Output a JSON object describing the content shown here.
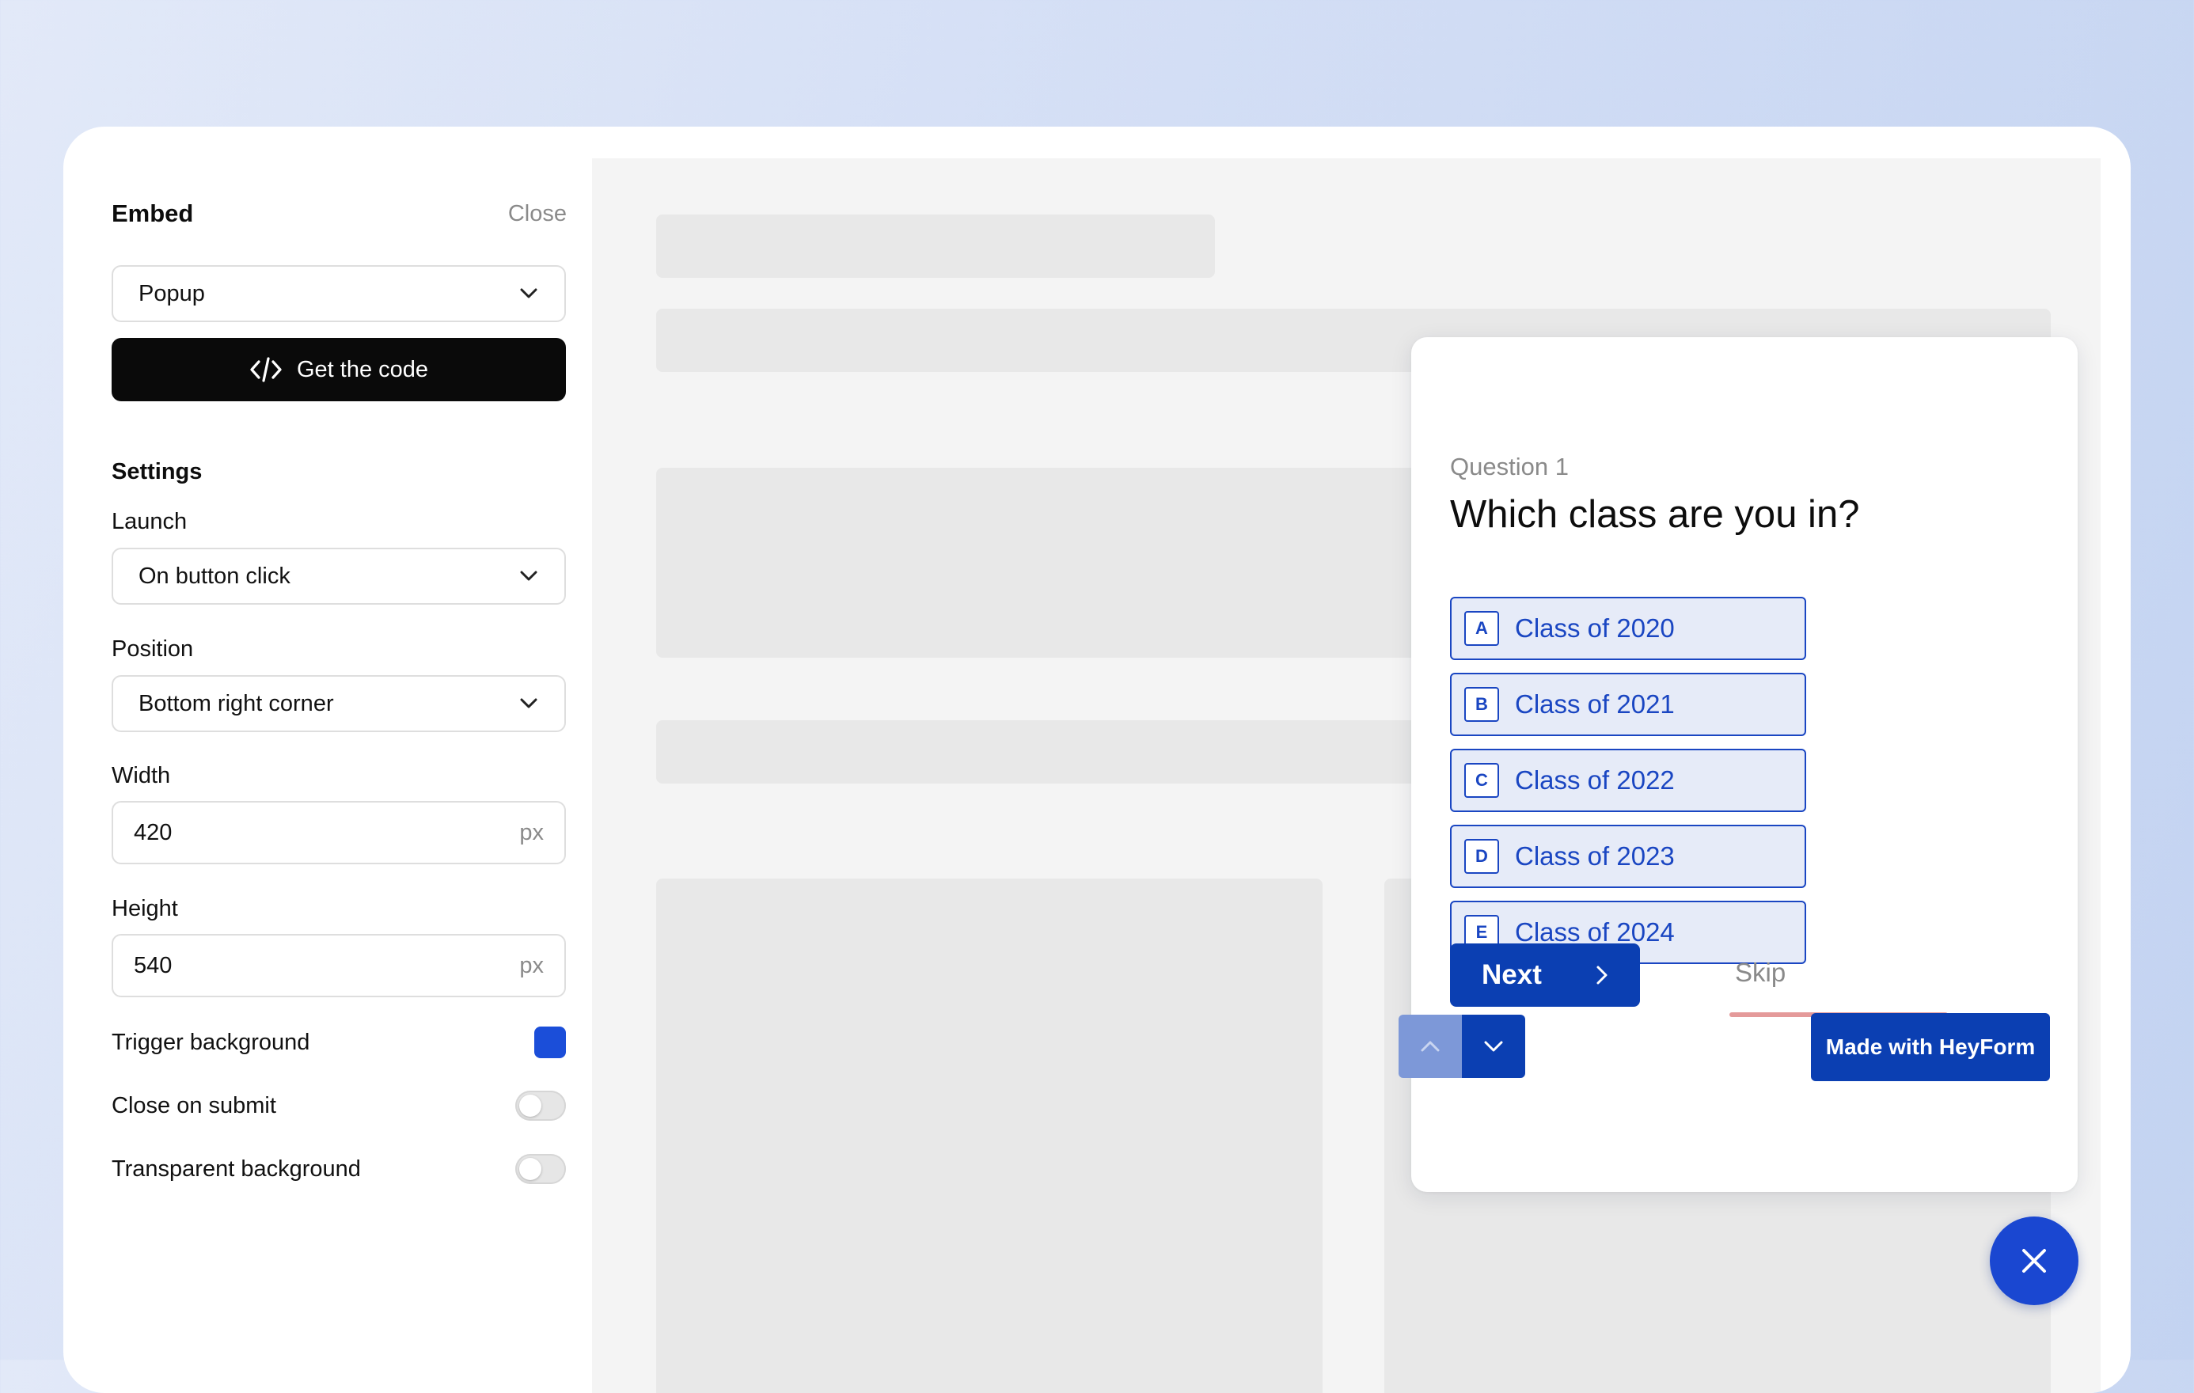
{
  "embed_panel": {
    "title": "Embed",
    "close_label": "Close",
    "embed_type": {
      "selected": "Popup",
      "icon": "chevron-down-icon"
    },
    "get_code": {
      "label": "Get the code",
      "icon": "code-icon"
    }
  },
  "settings": {
    "title": "Settings",
    "launch": {
      "label": "Launch",
      "selected": "On button click"
    },
    "position": {
      "label": "Position",
      "selected": "Bottom right corner"
    },
    "width": {
      "label": "Width",
      "value": "420",
      "unit": "px"
    },
    "height": {
      "label": "Height",
      "value": "540",
      "unit": "px"
    },
    "trigger_background": {
      "label": "Trigger background",
      "color": "#1b4ed9"
    },
    "close_on_submit": {
      "label": "Close on submit",
      "enabled": false
    },
    "transparent_background": {
      "label": "Transparent background",
      "enabled": false
    }
  },
  "popup": {
    "question_number": "Question 1",
    "question_title": "Which class are you in?",
    "choices": [
      {
        "key": "A",
        "label": "Class of 2020"
      },
      {
        "key": "B",
        "label": "Class of 2021"
      },
      {
        "key": "C",
        "label": "Class of 2022"
      },
      {
        "key": "D",
        "label": "Class of 2023"
      },
      {
        "key": "E",
        "label": "Class of 2024"
      }
    ],
    "next_label": "Next",
    "skip_label": "Skip",
    "branding": "Made with HeyForm",
    "accent_color": "#0b3fb2"
  },
  "fab": {
    "icon": "close-icon"
  }
}
